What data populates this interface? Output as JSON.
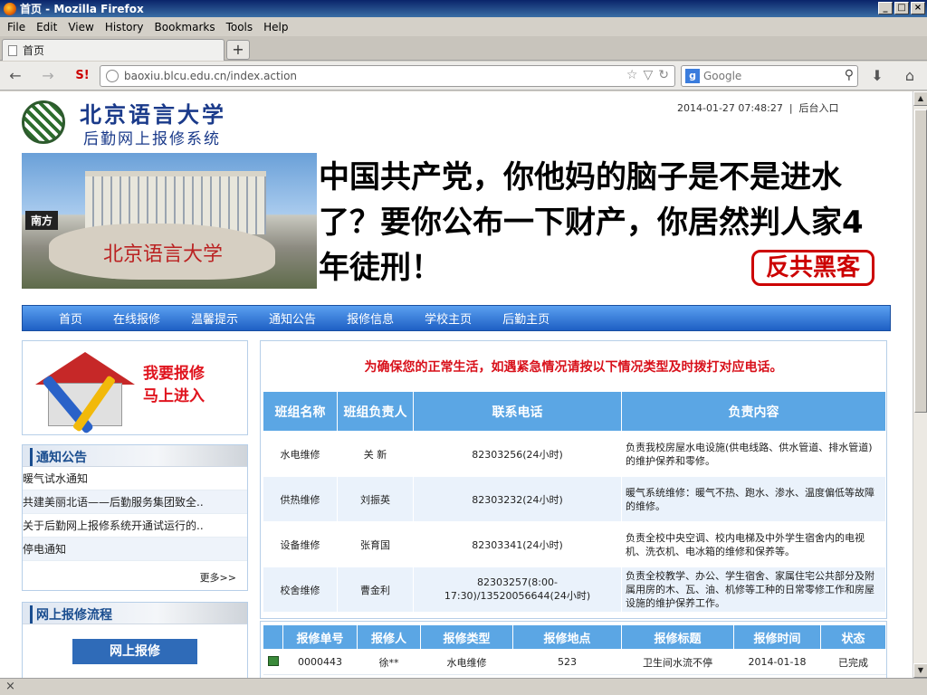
{
  "window": {
    "title": "首页 - Mozilla Firefox"
  },
  "menu": [
    "File",
    "Edit",
    "View",
    "History",
    "Bookmarks",
    "Tools",
    "Help"
  ],
  "tab": {
    "title": "首页"
  },
  "nav": {
    "url": "baoxiu.blcu.edu.cn/index.action",
    "search_placeholder": "Google"
  },
  "header": {
    "school_name": "北京语言大学",
    "system_name": "后勤网上报修系统",
    "datetime": "2014-01-27 07:48:27",
    "separator": "|",
    "admin_link": "后台入口"
  },
  "banner": {
    "photo_tag": "南方",
    "rock_text": "北京语言大学",
    "message": "中国共产党，你他妈的脑子是不是进水了？要你公布一下财产，你居然判人家4年徒刑！",
    "badge": "反共黑客"
  },
  "main_nav": [
    "首页",
    "在线报修",
    "温馨提示",
    "通知公告",
    "报修信息",
    "学校主页",
    "后勤主页"
  ],
  "repair_cta": {
    "line1": "我要报修",
    "line2": "马上进入"
  },
  "notices": {
    "title": "通知公告",
    "items": [
      "暖气试水通知",
      "共建美丽北语——后勤服务集团致全..",
      "关于后勤网上报修系统开通试运行的..",
      "停电通知"
    ],
    "more": "更多>>"
  },
  "flow": {
    "title": "网上报修流程",
    "step1": "网上报修"
  },
  "contacts": {
    "alert": "为确保您的正常生活，如遇紧急情况请按以下情况类型及时拨打对应电话。",
    "headers": [
      "班组名称",
      "班组负责人",
      "联系电话",
      "负责内容"
    ],
    "rows": [
      [
        "水电维修",
        "关  新",
        "82303256(24小时)",
        "负责我校房屋水电设施(供电线路、供水管道、排水管道)的维护保养和零修。"
      ],
      [
        "供热维修",
        "刘振英",
        "82303232(24小时)",
        "暖气系统维修：暖气不热、跑水、渗水、温度偏低等故障的维修。"
      ],
      [
        "设备维修",
        "张育国",
        "82303341(24小时)",
        "负责全校中央空调、校内电梯及中外学生宿舍内的电视机、洗衣机、电冰箱的维修和保养等。"
      ],
      [
        "校舍维修",
        "曹金利",
        "82303257(8:00-17:30)/13520056644(24小时)",
        "负责全校教学、办公、学生宿舍、家属住宅公共部分及附属用房的木、瓦、油、机修等工种的日常零修工作和房屋设施的维护保养工作。"
      ]
    ]
  },
  "orders": {
    "headers": [
      "报修单号",
      "报修人",
      "报修类型",
      "报修地点",
      "报修标题",
      "报修时间",
      "状态"
    ],
    "rows": [
      [
        "0000443",
        "徐**",
        "水电维修",
        "523",
        "卫生间水流不停",
        "2014-01-18",
        "已完成"
      ]
    ]
  },
  "status": {
    "text": "×"
  }
}
